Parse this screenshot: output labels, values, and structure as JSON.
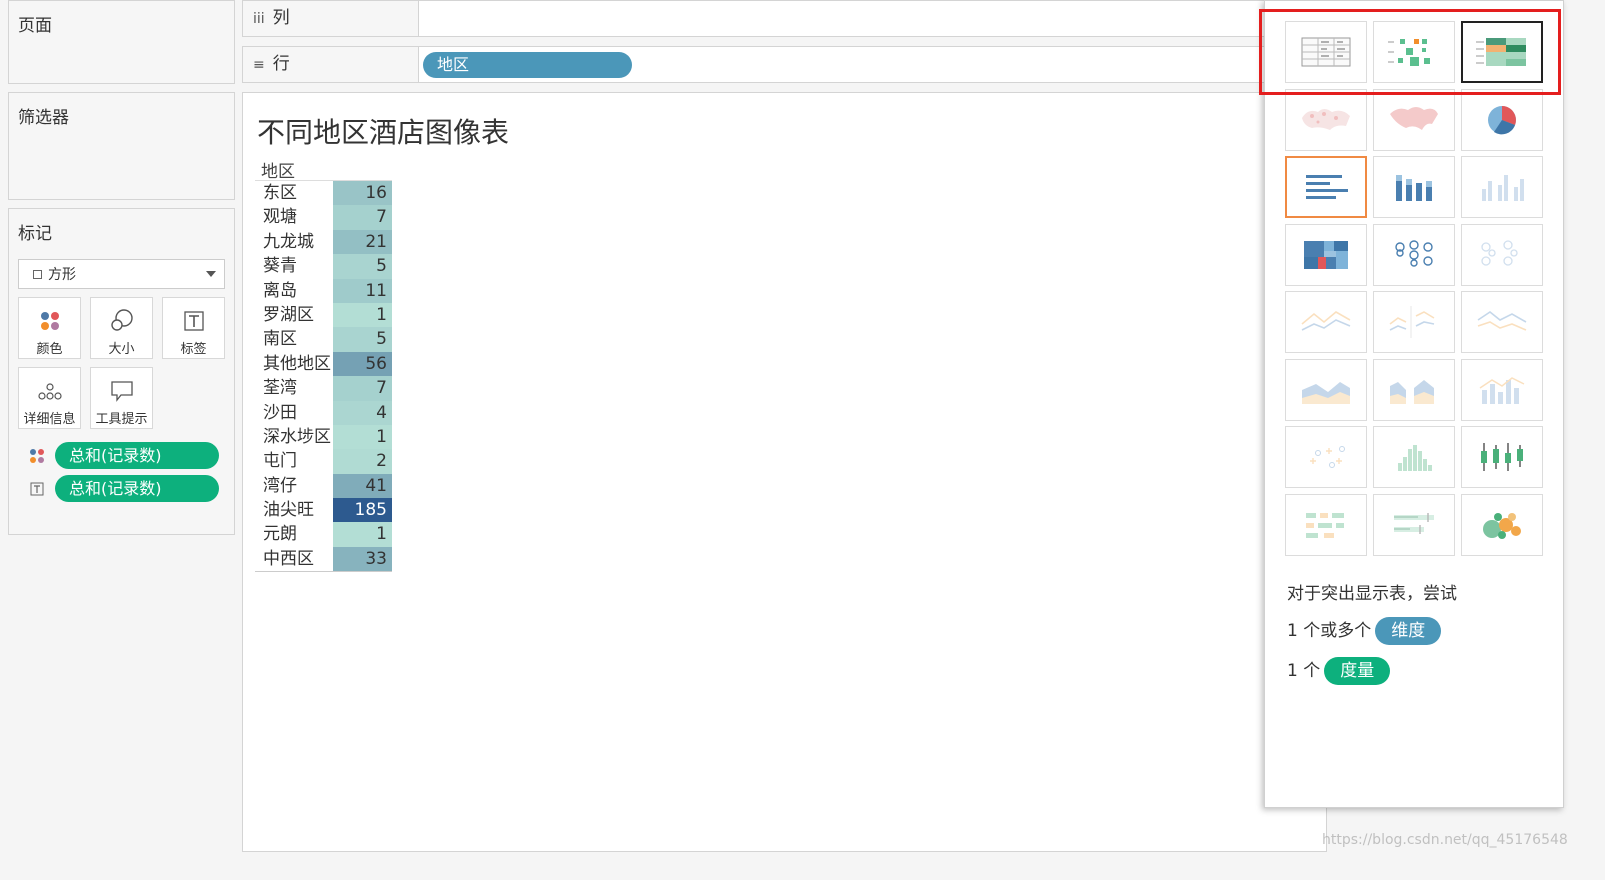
{
  "panels": {
    "pages_title": "页面",
    "filters_title": "筛选器",
    "marks_title": "标记"
  },
  "marks": {
    "type_selected": "方形",
    "buttons": [
      {
        "label": "颜色",
        "icon": "color-dots-icon"
      },
      {
        "label": "大小",
        "icon": "size-circles-icon"
      },
      {
        "label": "标签",
        "icon": "text-label-icon"
      },
      {
        "label": "详细信息",
        "icon": "detail-dots-icon"
      },
      {
        "label": "工具提示",
        "icon": "tooltip-icon"
      }
    ],
    "pills": [
      {
        "label": "总和(记录数)",
        "icon": "color-dots-icon"
      },
      {
        "label": "总和(记录数)",
        "icon": "text-label-icon"
      }
    ]
  },
  "shelves": {
    "columns_label": "列",
    "rows_label": "行",
    "rows_pill": "地区"
  },
  "view": {
    "title": "不同地区酒店图像表",
    "header": "地区",
    "rows": [
      {
        "label": "东区",
        "value": 16
      },
      {
        "label": "观塘",
        "value": 7
      },
      {
        "label": "九龙城",
        "value": 21
      },
      {
        "label": "葵青",
        "value": 5
      },
      {
        "label": "离岛",
        "value": 11
      },
      {
        "label": "罗湖区",
        "value": 1
      },
      {
        "label": "南区",
        "value": 5
      },
      {
        "label": "其他地区",
        "value": 56
      },
      {
        "label": "荃湾",
        "value": 7
      },
      {
        "label": "沙田",
        "value": 4
      },
      {
        "label": "深水埗区",
        "value": 1
      },
      {
        "label": "屯门",
        "value": 2
      },
      {
        "label": "湾仔",
        "value": 41
      },
      {
        "label": "油尖旺",
        "value": 185
      },
      {
        "label": "元朗",
        "value": 1
      },
      {
        "label": "中西区",
        "value": 33
      }
    ]
  },
  "showme": {
    "hint_line1": "对于突出显示表，尝试",
    "hint_line2_prefix": "1 个或多个",
    "hint_line2_pill": "维度",
    "hint_line3_prefix": "1 个",
    "hint_line3_pill": "度量",
    "tiles": [
      {
        "name": "text-table-icon",
        "state": "normal"
      },
      {
        "name": "heat-map-icon",
        "state": "normal"
      },
      {
        "name": "highlight-table-icon",
        "state": "selected"
      },
      {
        "name": "symbol-map-icon",
        "state": "faded"
      },
      {
        "name": "filled-map-icon",
        "state": "faded"
      },
      {
        "name": "pie-chart-icon",
        "state": "normal"
      },
      {
        "name": "horizontal-bars-icon",
        "state": "recommended"
      },
      {
        "name": "stacked-bars-icon",
        "state": "normal"
      },
      {
        "name": "side-by-side-bars-icon",
        "state": "faded"
      },
      {
        "name": "treemap-icon",
        "state": "normal"
      },
      {
        "name": "circle-views-icon",
        "state": "normal"
      },
      {
        "name": "side-by-side-circles-icon",
        "state": "faded"
      },
      {
        "name": "continuous-lines-icon",
        "state": "faded"
      },
      {
        "name": "discrete-lines-icon",
        "state": "faded"
      },
      {
        "name": "dual-lines-icon",
        "state": "faded"
      },
      {
        "name": "continuous-area-icon",
        "state": "faded"
      },
      {
        "name": "discrete-area-icon",
        "state": "faded"
      },
      {
        "name": "dual-combination-icon",
        "state": "faded"
      },
      {
        "name": "scatter-plot-icon",
        "state": "faded"
      },
      {
        "name": "histogram-icon",
        "state": "faded"
      },
      {
        "name": "box-whisker-icon",
        "state": "normal"
      },
      {
        "name": "gantt-chart-icon",
        "state": "faded"
      },
      {
        "name": "bullet-graph-icon",
        "state": "faded"
      },
      {
        "name": "packed-bubbles-icon",
        "state": "normal"
      }
    ]
  },
  "colors": {
    "dimension_pill": "#4b97b9",
    "measure_pill": "#0db07d",
    "highlight_box": "#e41e1e",
    "recommended_border": "#f08a43",
    "cell_low": "#b9e4d8",
    "cell_high": "#2d5a8f"
  },
  "watermark": "https://blog.csdn.net/qq_45176548"
}
